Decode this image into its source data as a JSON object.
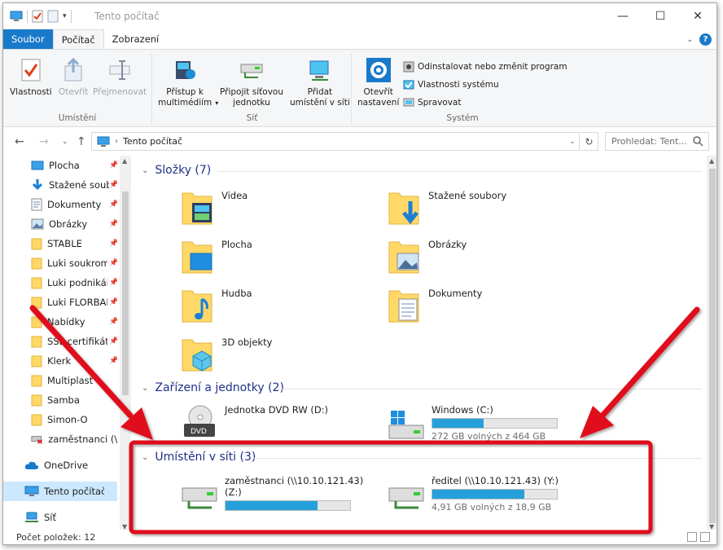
{
  "window": {
    "title": "Tento počítač",
    "minimize": "—",
    "maximize": "☐",
    "close": "✕"
  },
  "tabs": [
    {
      "label": "Soubor"
    },
    {
      "label": "Počítač"
    },
    {
      "label": "Zobrazení"
    }
  ],
  "ribbon": {
    "groups": {
      "umisteni": "Umístění",
      "sit": "Síť",
      "system": "Systém"
    },
    "buttons": {
      "vlastnosti": "Vlastnosti",
      "otevrit": "Otevřít",
      "prejmenovat": "Přejmenovat",
      "pristup": "Přístup k",
      "pristup2": "multimédiím",
      "pripojit": "Připojit síťovou",
      "pripojit2": "jednotku",
      "pridat": "Přidat",
      "pridat2": "umístění v síti",
      "otevrit_nastaveni": "Otevřít",
      "otevrit_nastaveni2": "nastavení",
      "odinstalovat": "Odinstalovat nebo změnit program",
      "vlastnosti_systemu": "Vlastnosti systému",
      "spravovat": "Spravovat"
    }
  },
  "address": {
    "path": "Tento počítač",
    "search_placeholder": "Prohledat: Tent..."
  },
  "navpane": {
    "quick": [
      {
        "label": "Plocha"
      },
      {
        "label": "Stažené soub"
      },
      {
        "label": "Dokumenty"
      },
      {
        "label": "Obrázky"
      },
      {
        "label": "STABLE"
      },
      {
        "label": "Luki soukrom"
      },
      {
        "label": "Luki podnikái"
      },
      {
        "label": "Luki FLORBAI"
      },
      {
        "label": "Nabídky"
      },
      {
        "label": "SSL certifikáty"
      },
      {
        "label": "Klerk"
      },
      {
        "label": "Multiplast"
      },
      {
        "label": "Samba"
      },
      {
        "label": "Simon-O"
      },
      {
        "label": "zaměstnanci (\\\\1"
      }
    ],
    "onedrive": "OneDrive",
    "thispc": "Tento počítač",
    "network": "Síť"
  },
  "content": {
    "folders_header": "Složky (7)",
    "folders": [
      {
        "name": "Videa"
      },
      {
        "name": "Stažené soubory"
      },
      {
        "name": "Plocha"
      },
      {
        "name": "Obrázky"
      },
      {
        "name": "Hudba"
      },
      {
        "name": "Dokumenty"
      },
      {
        "name": "3D objekty"
      }
    ],
    "devices_header": "Zařízení a jednotky (2)",
    "devices": [
      {
        "name": "Jednotka DVD RW (D:)"
      },
      {
        "name": "Windows (C:)",
        "free": "272 GB volných z 464 GB",
        "used_fraction": 0.41
      }
    ],
    "network_header": "Umístění v síti (3)",
    "network": [
      {
        "name": "zaměstnanci (\\\\10.10.121.43)",
        "name2": "(Z:)",
        "used_fraction": 0.74
      },
      {
        "name": "ředitel (\\\\10.10.121.43) (Y:)",
        "free": "4,91 GB volných z 18,9 GB",
        "used_fraction": 0.74
      }
    ]
  },
  "status": {
    "count": "Počet položek: 12"
  },
  "colors": {
    "accent": "#1979ca",
    "annotation": "#e0101b",
    "progress": "#26a0da"
  }
}
